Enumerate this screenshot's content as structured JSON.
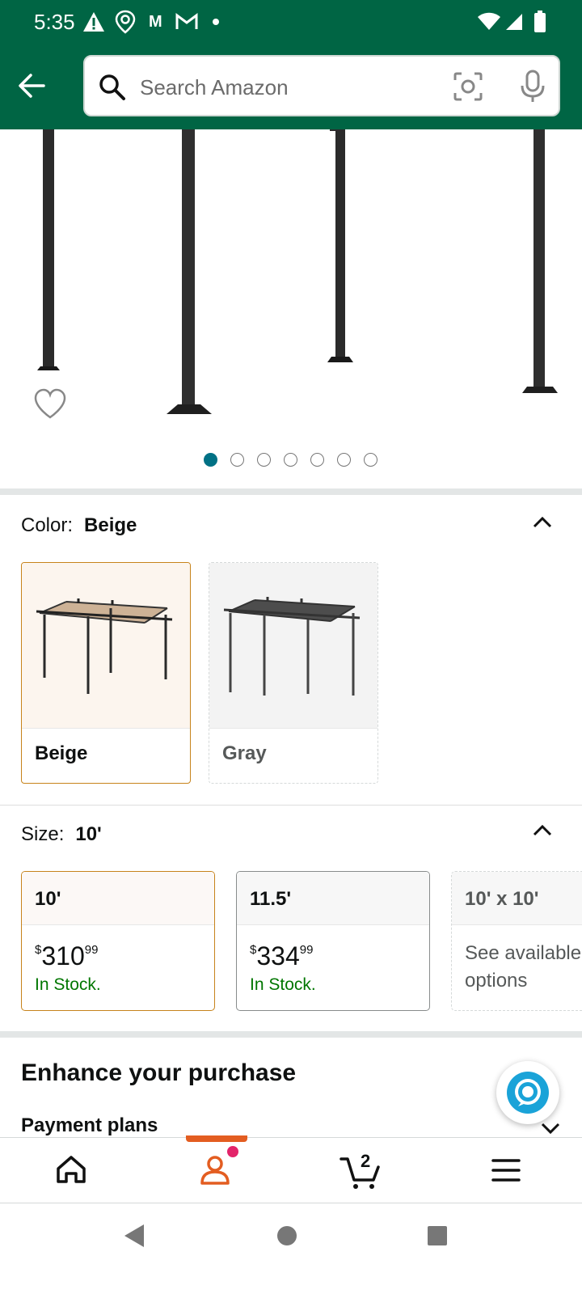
{
  "status_bar": {
    "time": "5:35",
    "icons": [
      "alert-icon",
      "location-icon",
      "m-icon",
      "gmail-icon",
      "dot-icon",
      "wifi-icon",
      "signal-icon",
      "battery-icon"
    ]
  },
  "header": {
    "search_placeholder": "Search Amazon",
    "icons": [
      "back-arrow-icon",
      "search-icon",
      "camera-icon",
      "mic-icon"
    ]
  },
  "gallery": {
    "total_images": 7,
    "active_index": 0
  },
  "color": {
    "label": "Color:",
    "selected": "Beige",
    "options": [
      {
        "name": "Beige",
        "selected": true
      },
      {
        "name": "Gray",
        "selected": false
      }
    ]
  },
  "size": {
    "label": "Size:",
    "selected": "10'",
    "options": [
      {
        "name": "10'",
        "price_symbol": "$",
        "price_whole": "310",
        "price_fraction": "99",
        "stock": "In Stock.",
        "selected": true
      },
      {
        "name": "11.5'",
        "price_symbol": "$",
        "price_whole": "334",
        "price_fraction": "99",
        "stock": "In Stock.",
        "selected": false
      },
      {
        "name": "10' x 10'",
        "see_options": "See available options",
        "selected": false
      }
    ]
  },
  "enhance": {
    "title": "Enhance your purchase",
    "payment_plans": "Payment plans"
  },
  "bottom_nav": {
    "cart_count": "2",
    "items": [
      "home-icon",
      "account-icon",
      "cart-icon",
      "menu-icon"
    ],
    "active": "account-icon"
  },
  "colors": {
    "header_green": "#006544",
    "selected_border": "#c7831b",
    "in_stock": "#007600",
    "active_dot": "#007185",
    "nav_active": "#e35d21"
  }
}
